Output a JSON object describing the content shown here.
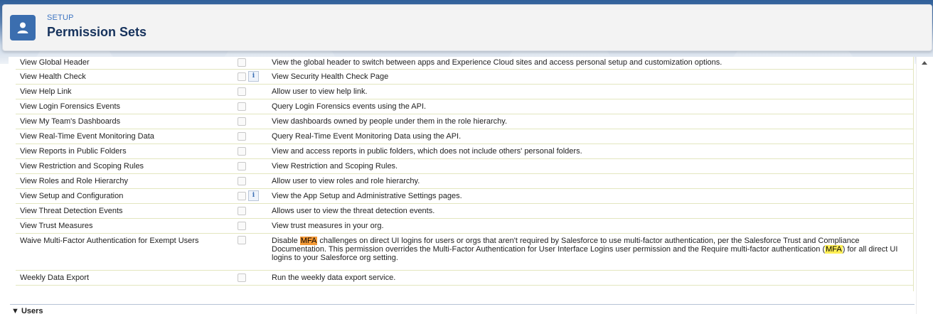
{
  "header": {
    "breadcrumb": "SETUP",
    "title": "Permission Sets"
  },
  "permissions": [
    {
      "name": "View Global Header",
      "desc": "View the global header to switch between apps and Experience Cloud sites and access personal setup and customization options.",
      "info": false
    },
    {
      "name": "View Health Check",
      "desc": "View Security Health Check Page",
      "info": true
    },
    {
      "name": "View Help Link",
      "desc": "Allow user to view help link.",
      "info": false
    },
    {
      "name": "View Login Forensics Events",
      "desc": "Query Login Forensics events using the API.",
      "info": false
    },
    {
      "name": "View My Team's Dashboards",
      "desc": "View dashboards owned by people under them in the role hierarchy.",
      "info": false
    },
    {
      "name": "View Real-Time Event Monitoring Data",
      "desc": "Query Real-Time Event Monitoring Data using the API.",
      "info": false
    },
    {
      "name": "View Reports in Public Folders",
      "desc": "View and access reports in public folders, which does not include others' personal folders.",
      "info": false
    },
    {
      "name": "View Restriction and Scoping Rules",
      "desc": "View Restriction and Scoping Rules.",
      "info": false
    },
    {
      "name": "View Roles and Role Hierarchy",
      "desc": "Allow user to view roles and role hierarchy.",
      "info": false
    },
    {
      "name": "View Setup and Configuration",
      "desc": "View the App Setup and Administrative Settings pages.",
      "info": true
    },
    {
      "name": "View Threat Detection Events",
      "desc": "Allows user to view the threat detection events.",
      "info": false
    },
    {
      "name": "View Trust Measures",
      "desc": "View trust measures in your org.",
      "info": false
    },
    {
      "name": "Waive Multi-Factor Authentication for Exempt Users",
      "desc_parts": {
        "a": "Disable ",
        "b": "MFA",
        "c": " challenges on direct UI logins for users or orgs that aren't required by Salesforce to use multi-factor authentication, per the Salesforce Trust and Compliance Documentation. This permission overrides the Multi-Factor Authentication for User Interface Logins user permission and the Require multi-factor authentication (",
        "d": "MFA",
        "e": ") for all direct UI logins to your Salesforce org setting."
      },
      "info": false
    },
    {
      "name": "Weekly Data Export",
      "desc": "Run the weekly data export service.",
      "info": false
    }
  ],
  "info_glyph": "i",
  "section": {
    "arrow": "▼",
    "label": "Users"
  },
  "colors": {
    "highlight_current": "#f59a36",
    "highlight_match": "#ffee55",
    "brand": "#3b6eaf"
  },
  "icons": [
    "user-icon",
    "info-icon",
    "scroll-up-arrow-icon"
  ]
}
